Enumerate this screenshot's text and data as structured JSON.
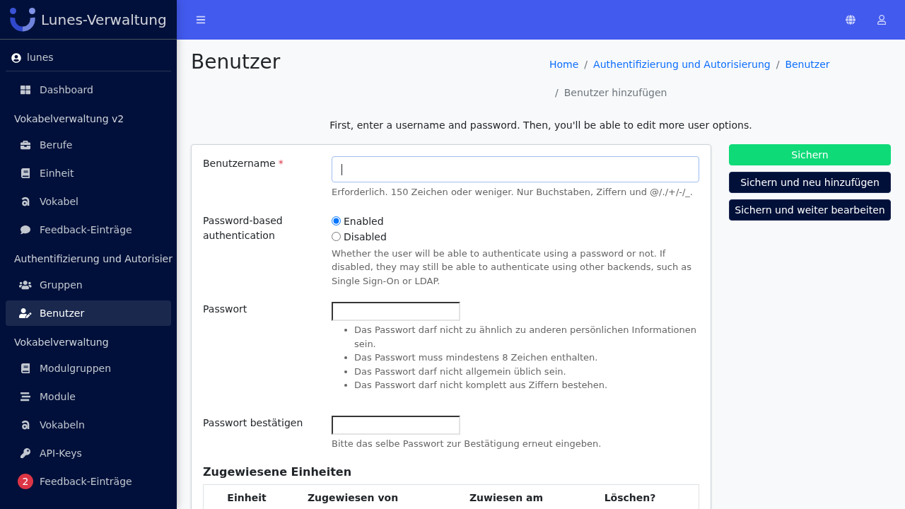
{
  "sidebar": {
    "brand": "Lunes-Verwaltung",
    "user": "lunes",
    "nav": [
      {
        "kind": "link",
        "label": "Dashboard",
        "selected": false
      },
      {
        "kind": "header",
        "label": "Vokabelverwaltung v2"
      },
      {
        "kind": "link",
        "label": "Berufe",
        "selected": false
      },
      {
        "kind": "link",
        "label": "Einheit",
        "selected": false
      },
      {
        "kind": "link",
        "label": "Vokabel",
        "selected": false
      },
      {
        "kind": "link",
        "label": "Feedback-Einträge",
        "selected": false
      },
      {
        "kind": "header",
        "label": "Authentifizierung und Autorisier"
      },
      {
        "kind": "link",
        "label": "Gruppen",
        "selected": false
      },
      {
        "kind": "link",
        "label": "Benutzer",
        "selected": true
      },
      {
        "kind": "header",
        "label": "Vokabelverwaltung"
      },
      {
        "kind": "link",
        "label": "Modulgruppen",
        "selected": false
      },
      {
        "kind": "link",
        "label": "Module",
        "selected": false
      },
      {
        "kind": "link",
        "label": "Vokabeln",
        "selected": false
      },
      {
        "kind": "link",
        "label": "API-Keys",
        "selected": false
      },
      {
        "kind": "link",
        "label": "Feedback-Einträge",
        "selected": false,
        "badge": "2"
      }
    ]
  },
  "page": {
    "title": "Benutzer",
    "breadcrumb": [
      {
        "kind": "link",
        "label": "Home"
      },
      {
        "kind": "link",
        "separator": "/",
        "label": "Authentifizierung und Autorisierung"
      },
      {
        "kind": "link",
        "separator": "/",
        "label": "Benutzer"
      },
      {
        "kind": "current",
        "separator": "/",
        "label": "Benutzer hinzufügen"
      }
    ],
    "intro": "First, enter a username and password. Then, you'll be able to edit more user options."
  },
  "form": {
    "fields": [
      {
        "kind": "text",
        "label": "Benutzername",
        "required_mark": "*",
        "focused": true,
        "help": "Erforderlich. 150 Zeichen oder weniger. Nur Buchstaben, Ziffern und @/./+/-/_."
      },
      {
        "kind": "radio",
        "label": "Password-based authentication",
        "options": [
          {
            "label": "Enabled",
            "selected": true
          },
          {
            "label": "Disabled",
            "selected": false
          }
        ],
        "help": "Whether the user will be able to authenticate using a password or not. If disabled, they may still be able to authenticate using other backends, such as Single Sign-On or LDAP."
      },
      {
        "kind": "password",
        "label": "Passwort",
        "focused": false,
        "rules": [
          "Das Passwort darf nicht zu ähnlich zu anderen persönlichen Informationen sein.",
          "Das Passwort muss mindestens 8 Zeichen enthalten.",
          "Das Passwort darf nicht allgemein üblich sein.",
          "Das Passwort darf nicht komplett aus Ziffern bestehen."
        ]
      },
      {
        "kind": "password",
        "label": "Passwort bestätigen",
        "focused": false,
        "help": "Bitte das selbe Passwort zur Bestätigung erneut eingeben."
      }
    ],
    "inline": {
      "title": "Zugewiesene Einheiten",
      "columns": [
        "Einheit",
        "Zugewiesen von",
        "Zuwiesen am",
        "Löschen?"
      ]
    }
  },
  "actions": [
    {
      "kind": "primary",
      "label": "Sichern"
    },
    {
      "kind": "secondary",
      "label": "Sichern und neu hinzufügen"
    },
    {
      "kind": "secondary",
      "label": "Sichern und weiter bearbeiten"
    }
  ]
}
